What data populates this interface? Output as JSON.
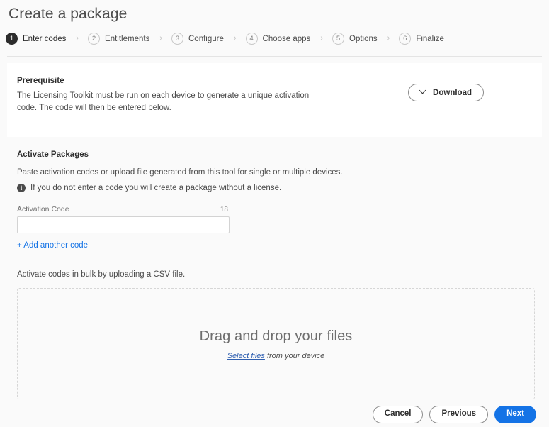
{
  "page": {
    "title": "Create a package"
  },
  "stepper": {
    "separator": "›",
    "steps": [
      {
        "number": "1",
        "label": "Enter codes",
        "state": "active"
      },
      {
        "number": "2",
        "label": "Entitlements",
        "state": "inactive"
      },
      {
        "number": "3",
        "label": "Configure",
        "state": "inactive"
      },
      {
        "number": "4",
        "label": "Choose apps",
        "state": "inactive"
      },
      {
        "number": "5",
        "label": "Options",
        "state": "inactive"
      },
      {
        "number": "6",
        "label": "Finalize",
        "state": "inactive"
      }
    ]
  },
  "prerequisite": {
    "title": "Prerequisite",
    "body": "The Licensing Toolkit must be run on each device to generate a unique activation code. The code will then be entered below.",
    "download_label": "Download",
    "download_icon": "chevron-down-icon"
  },
  "activate": {
    "title": "Activate Packages",
    "subtitle": "Paste activation codes or upload file generated from this tool for single or multiple devices.",
    "note_icon": "info-icon",
    "note_icon_glyph": "i",
    "note": "If you do not enter a code you will create a package without a license.",
    "field": {
      "label": "Activation Code",
      "counter": "18",
      "value": "",
      "placeholder": ""
    },
    "add_another_label": "+ Add another code"
  },
  "bulk": {
    "label": "Activate codes in bulk by uploading a CSV file.",
    "dropzone_title": "Drag and drop your files",
    "dropzone_link": "Select files",
    "dropzone_suffix": " from your device"
  },
  "footer": {
    "cancel_label": "Cancel",
    "previous_label": "Previous",
    "next_label": "Next"
  },
  "colors": {
    "accent": "#1473E6",
    "link": "#2F5FB0",
    "page_background": "#FAFAFA",
    "card_background": "#FFFFFF",
    "text": "#2C2C2C",
    "muted_text": "#6E6E6E"
  }
}
